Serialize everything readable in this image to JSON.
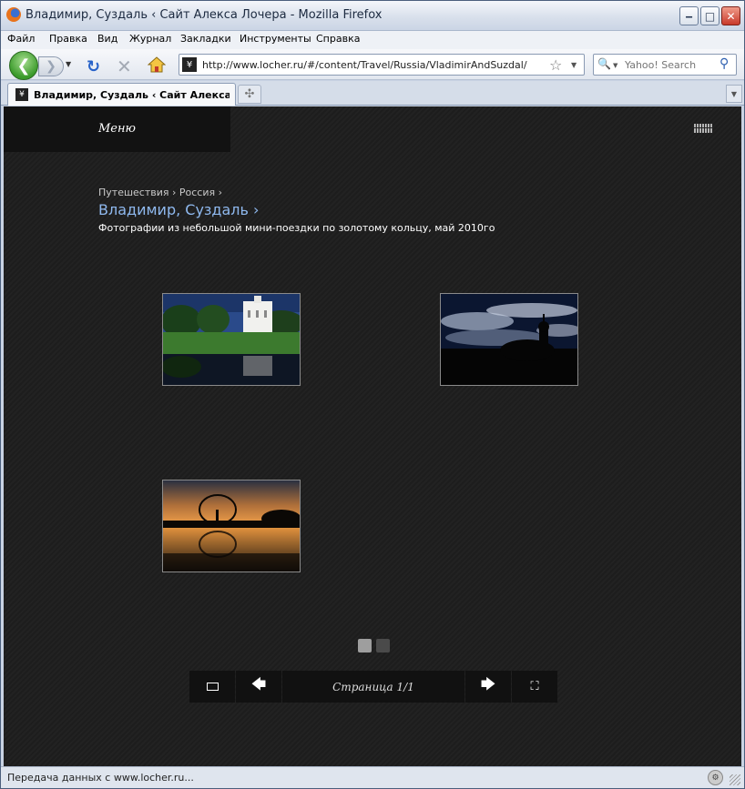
{
  "window": {
    "title": "Владимир, Суздаль ‹ Сайт Алекса Лочера - Mozilla Firefox",
    "minimize": "‒",
    "maximize": "□",
    "close": "✕"
  },
  "menubar": {
    "items": [
      "Файл",
      "Правка",
      "Вид",
      "Журнал",
      "Закладки",
      "Инструменты",
      "Справка"
    ]
  },
  "navbar": {
    "url": "http://www.locher.ru/#/content/Travel/Russia/VladimirAndSuzdal/",
    "search_placeholder": "Yahoo! Search",
    "icons": [
      "back-icon",
      "forward-icon",
      "reload-icon",
      "stop-icon",
      "home-icon",
      "bookmark-star-icon",
      "search-icon"
    ]
  },
  "tabs": [
    {
      "label": "Владимир, Суздаль ‹ Сайт Алекса Л...",
      "active": true
    }
  ],
  "page": {
    "menu_label": "Меню",
    "breadcrumb": [
      "Путешествия ›",
      "Россия ›"
    ],
    "title": "Владимир, Суздаль ›",
    "subtitle": "Фотографии из небольшой мини-поездки по золотому кольцу, май 2010го",
    "thumbnails": [
      {
        "subject": "white church by pond"
      },
      {
        "subject": "church silhouette under cloudy sky"
      },
      {
        "subject": "tree silhouette at sunset over water"
      }
    ],
    "pager": {
      "pages": 2,
      "current": 1
    },
    "controls": {
      "page_info": "Страница 1/1",
      "prev": "🡄",
      "next": "🡆",
      "fullscreen": "⛶"
    }
  },
  "statusbar": {
    "text": "Передача данных с www.locher.ru..."
  },
  "colors": {
    "page_bg": "#1f1f1f",
    "title_link": "#8fb9ef",
    "menu_block": "#121212"
  }
}
